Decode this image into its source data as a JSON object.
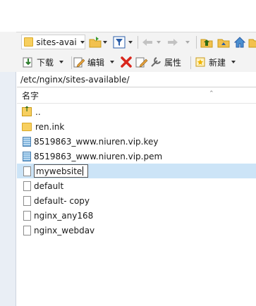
{
  "toolbar": {
    "location_combo": "sites-avai",
    "download_label": "下载",
    "edit_label": "编辑",
    "properties_label": "属性",
    "new_label": "新建"
  },
  "path": "/etc/nginx/sites-available/",
  "columns": {
    "name": "名字"
  },
  "files": [
    {
      "name": "..",
      "icon": "parent-folder-icon"
    },
    {
      "name": "ren.ink",
      "icon": "folder-icon"
    },
    {
      "name": "8519863_www.niuren.vip.key",
      "icon": "certificate-file-icon"
    },
    {
      "name": "8519863_www.niuren.vip.pem",
      "icon": "certificate-file-icon"
    },
    {
      "name": "mywebsite",
      "icon": "file-icon",
      "renaming": true
    },
    {
      "name": "default",
      "icon": "file-icon"
    },
    {
      "name": "default- copy",
      "icon": "file-icon"
    },
    {
      "name": "nginx_any168",
      "icon": "file-icon"
    },
    {
      "name": "nginx_webdav",
      "icon": "file-icon"
    }
  ]
}
